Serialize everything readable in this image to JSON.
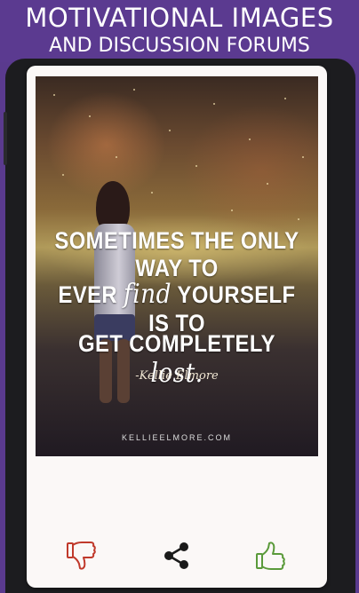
{
  "banner": {
    "line1": "MOTIVATIONAL IMAGES",
    "line2": "AND DISCUSSION FORUMS",
    "color": "#5b3a90"
  },
  "post": {
    "quote": {
      "line1": "SOMETIMES THE ONLY WAY TO",
      "line2_pre": "EVER ",
      "line2_script": "find",
      "line2_post": " YOURSELF IS TO",
      "line3_pre": "GET COMPLETELY ",
      "line3_script": "lost."
    },
    "author": "-Kellie Elmore",
    "site": "KELLIEELMORE.COM"
  },
  "actions": {
    "dislike": {
      "icon": "thumbs-down-icon",
      "color": "#c0392b"
    },
    "share": {
      "icon": "share-icon",
      "color": "#1a1a1a"
    },
    "like": {
      "icon": "thumbs-up-icon",
      "color": "#5a9a3a"
    }
  }
}
